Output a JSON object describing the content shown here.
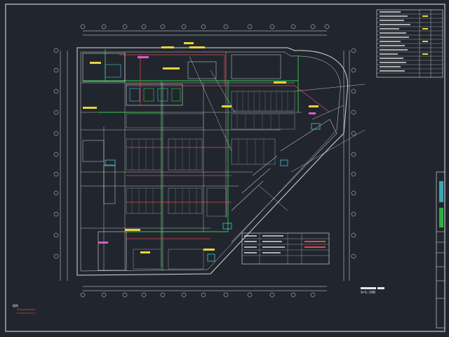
{
  "colors": {
    "background": "#21262e",
    "border": "#e8e8e8",
    "wall": "#d9d9d9",
    "green_pipe": "#31d14a",
    "red_pipe": "#e04b4b",
    "cyan": "#3ec9d6",
    "yellow": "#e6d43a",
    "magenta": "#d85cc8"
  },
  "icons": {
    "leader": "leader-line",
    "equipment": "equipment-block",
    "parking": "parking-stall"
  },
  "drawing": {
    "scale_text": "S=1:100",
    "legend_tag": "图例"
  }
}
